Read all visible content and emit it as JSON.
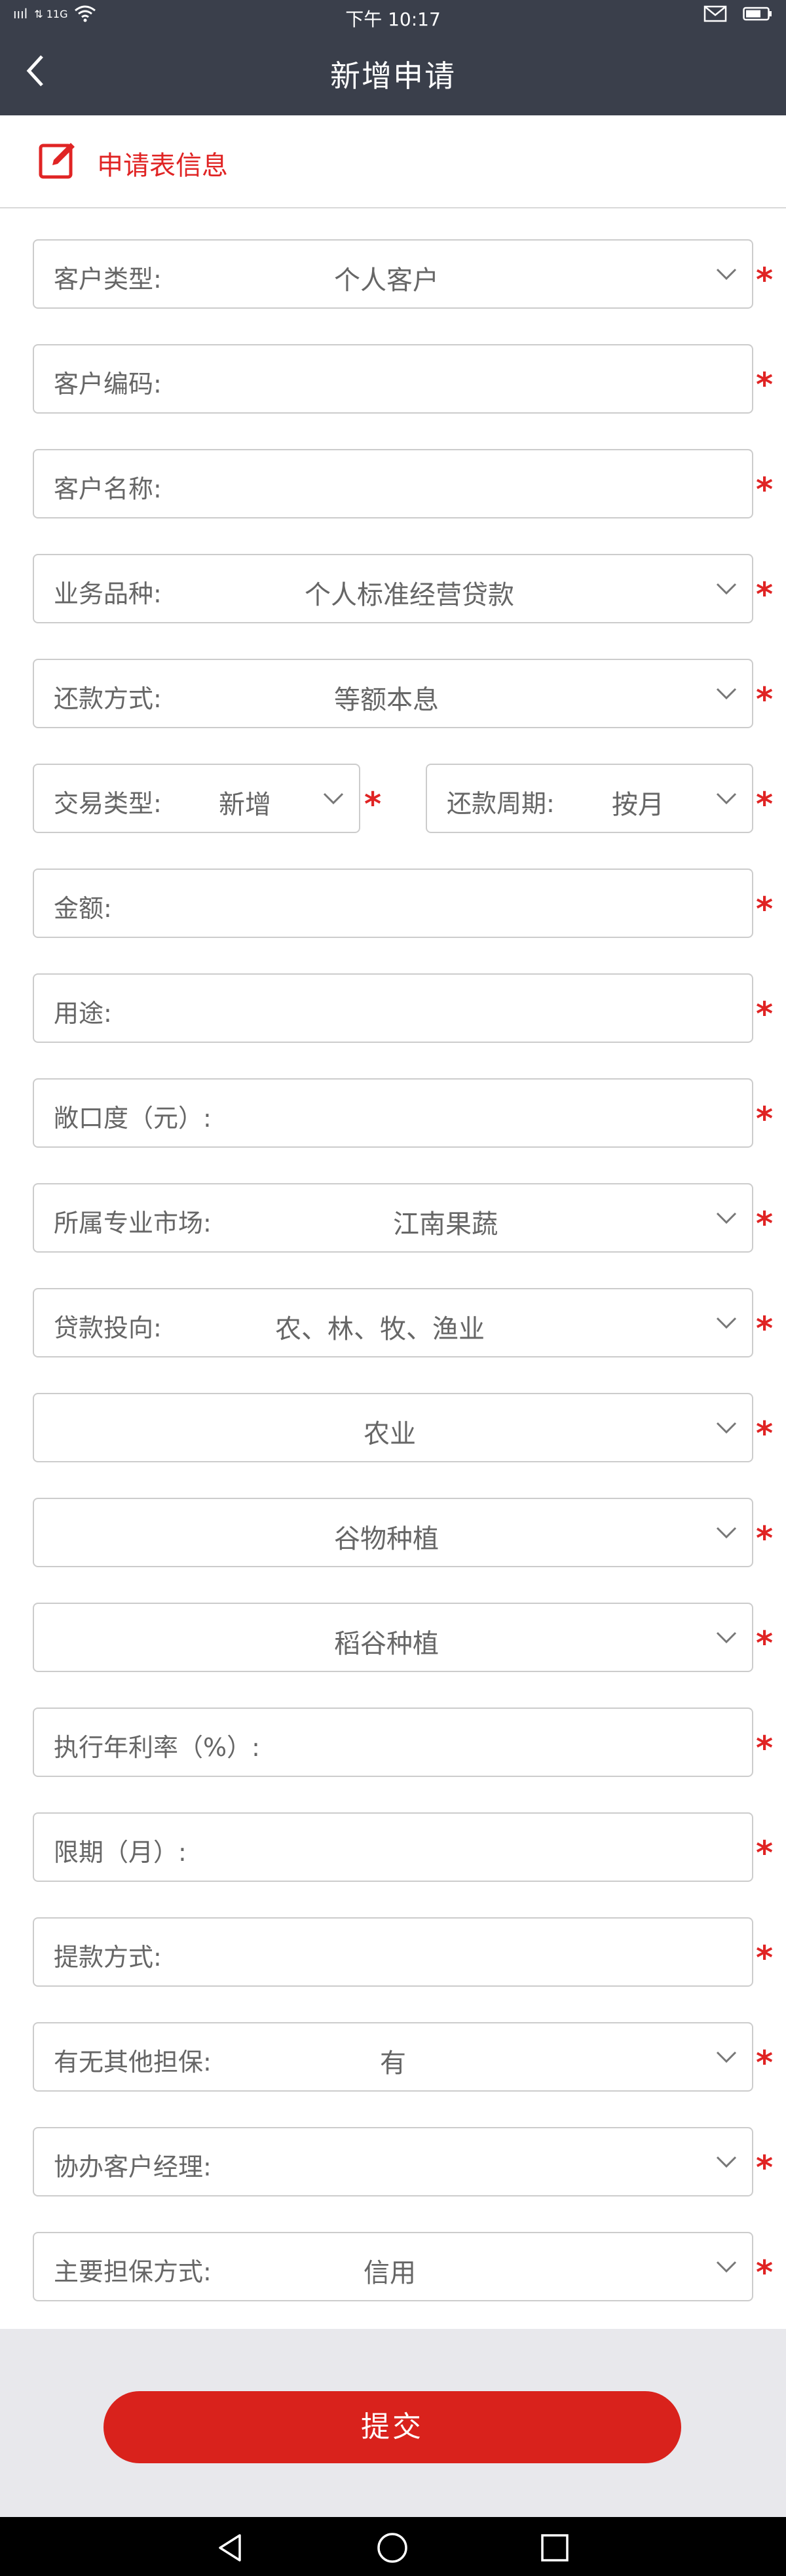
{
  "status_bar": {
    "signal": "ıııl",
    "network": "⇅ 11G",
    "time": "下午 10:17"
  },
  "header": {
    "title": "新增申请"
  },
  "section": {
    "title": "申请表信息"
  },
  "form": {
    "customer_type": {
      "label": "客户类型:",
      "value": "个人客户"
    },
    "customer_code": {
      "label": "客户编码:"
    },
    "customer_name": {
      "label": "客户名称:"
    },
    "business_type": {
      "label": "业务品种:",
      "value": "个人标准经营贷款"
    },
    "repayment_method": {
      "label": "还款方式:",
      "value": "等额本息"
    },
    "transaction_type": {
      "label": "交易类型:",
      "value": "新增"
    },
    "repayment_cycle": {
      "label": "还款周期:",
      "value": "按月"
    },
    "amount": {
      "label": "金额:"
    },
    "purpose": {
      "label": "用途:"
    },
    "exposure": {
      "label": "敞口度（元）:"
    },
    "market": {
      "label": "所属专业市场:",
      "value": "江南果蔬"
    },
    "loan_direction": {
      "label": "贷款投向:",
      "value": "农、林、牧、渔业"
    },
    "industry_1": {
      "value": "农业"
    },
    "industry_2": {
      "value": "谷物种植"
    },
    "industry_3": {
      "value": "稻谷种植"
    },
    "annual_rate": {
      "label": "执行年利率（%）:"
    },
    "term": {
      "label": "限期（月）:"
    },
    "withdrawal_method": {
      "label": "提款方式:"
    },
    "other_guarantee": {
      "label": "有无其他担保:",
      "value": "有"
    },
    "co_manager": {
      "label": "协办客户经理:"
    },
    "main_guarantee": {
      "label": "主要担保方式:",
      "value": "信用"
    },
    "required_mark": "*"
  },
  "actions": {
    "submit_label": "提交"
  },
  "colors": {
    "accent": "#d9221c",
    "header_bg": "#3a3f4b"
  }
}
